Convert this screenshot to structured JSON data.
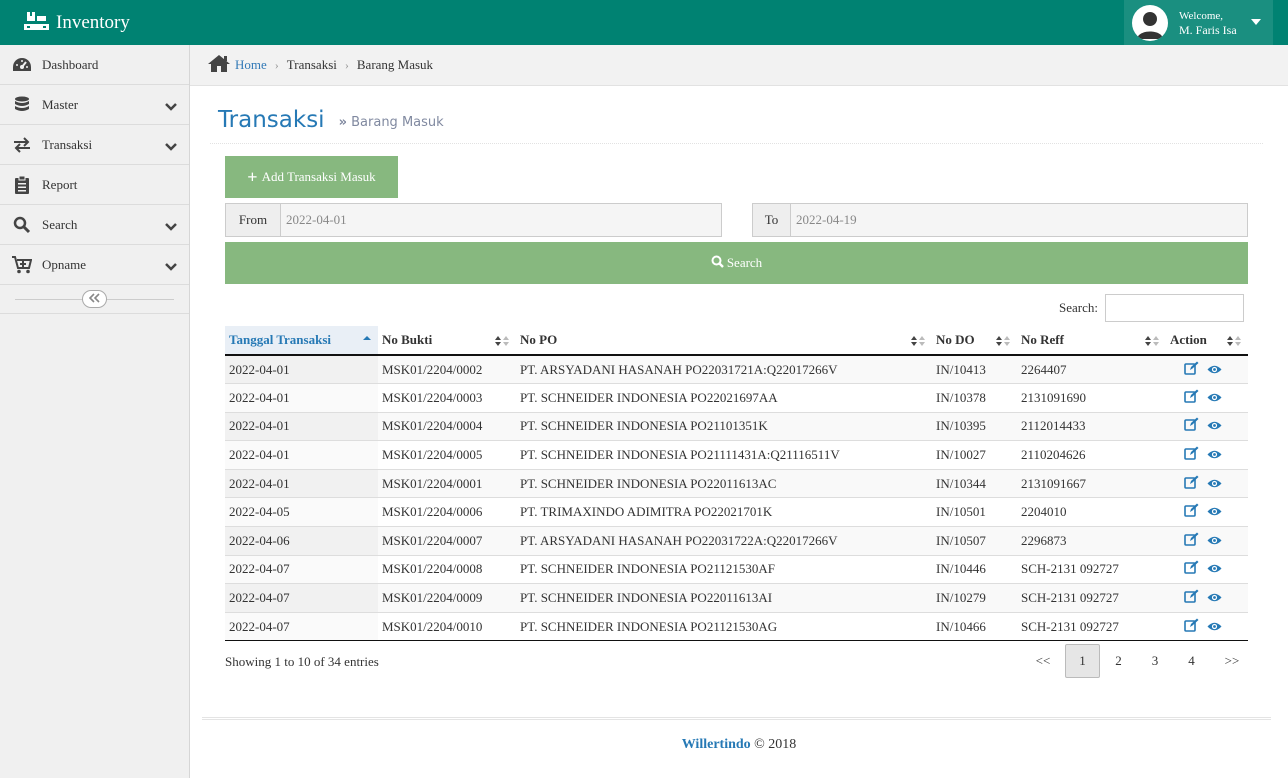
{
  "app": {
    "title": "Inventory"
  },
  "user": {
    "welcome": "Welcome,",
    "name": "M. Faris Isa"
  },
  "sidebar": {
    "items": [
      {
        "label": "Dashboard",
        "icon": "tachometer-icon",
        "has_submenu": false
      },
      {
        "label": "Master",
        "icon": "database-icon",
        "has_submenu": true
      },
      {
        "label": "Transaksi",
        "icon": "exchange-icon",
        "has_submenu": true
      },
      {
        "label": "Report",
        "icon": "clipboard-icon",
        "has_submenu": false
      },
      {
        "label": "Search",
        "icon": "search-icon",
        "has_submenu": true
      },
      {
        "label": "Opname",
        "icon": "cart-plus-icon",
        "has_submenu": true
      }
    ]
  },
  "breadcrumb": {
    "home": "Home",
    "section": "Transaksi",
    "current": "Barang Masuk"
  },
  "page": {
    "title": "Transaksi",
    "subtitle": "Barang Masuk"
  },
  "actions": {
    "add_label": "Add Transaksi Masuk",
    "search_label": "Search"
  },
  "filter": {
    "from_label": "From",
    "from_value": "2022-04-01",
    "to_label": "To",
    "to_value": "2022-04-19"
  },
  "table": {
    "search_label": "Search:",
    "search_value": "",
    "columns": [
      "Tanggal Transaksi",
      "No Bukti",
      "No PO",
      "No DO",
      "No Reff",
      "Action"
    ],
    "sorted_column": "Tanggal Transaksi",
    "sort_direction": "asc",
    "rows": [
      [
        "2022-04-01",
        "MSK01/2204/0002",
        "PT. ARSYADANI HASANAH PO22031721A:Q22017266V",
        "IN/10413",
        "2264407"
      ],
      [
        "2022-04-01",
        "MSK01/2204/0003",
        "PT. SCHNEIDER INDONESIA PO22021697AA",
        "IN/10378",
        "2131091690"
      ],
      [
        "2022-04-01",
        "MSK01/2204/0004",
        "PT. SCHNEIDER INDONESIA PO21101351K",
        "IN/10395",
        "2112014433"
      ],
      [
        "2022-04-01",
        "MSK01/2204/0005",
        "PT. SCHNEIDER INDONESIA PO21111431A:Q21116511V",
        "IN/10027",
        "2110204626"
      ],
      [
        "2022-04-01",
        "MSK01/2204/0001",
        "PT. SCHNEIDER INDONESIA PO22011613AC",
        "IN/10344",
        "2131091667"
      ],
      [
        "2022-04-05",
        "MSK01/2204/0006",
        "PT. TRIMAXINDO ADIMITRA PO22021701K",
        "IN/10501",
        "2204010"
      ],
      [
        "2022-04-06",
        "MSK01/2204/0007",
        "PT. ARSYADANI HASANAH PO22031722A:Q22017266V",
        "IN/10507",
        "2296873"
      ],
      [
        "2022-04-07",
        "MSK01/2204/0008",
        "PT. SCHNEIDER INDONESIA PO21121530AF",
        "IN/10446",
        "SCH-2131 092727"
      ],
      [
        "2022-04-07",
        "MSK01/2204/0009",
        "PT. SCHNEIDER INDONESIA PO22011613AI",
        "IN/10279",
        "SCH-2131 092727"
      ],
      [
        "2022-04-07",
        "MSK01/2204/0010",
        "PT. SCHNEIDER INDONESIA PO21121530AG",
        "IN/10466",
        "SCH-2131 092727"
      ]
    ],
    "row_actions": [
      "edit-icon",
      "eye-icon"
    ]
  },
  "pagination": {
    "info": "Showing 1 to 10 of 34 entries",
    "prev": "<<",
    "pages": [
      "1",
      "2",
      "3",
      "4"
    ],
    "active_page": "1",
    "next": ">>"
  },
  "footer": {
    "brand": "Willertindo",
    "text": "© 2018"
  },
  "colors": {
    "topbar": "#008272",
    "accent_green": "#87b87f",
    "link_blue": "#2679b5"
  }
}
